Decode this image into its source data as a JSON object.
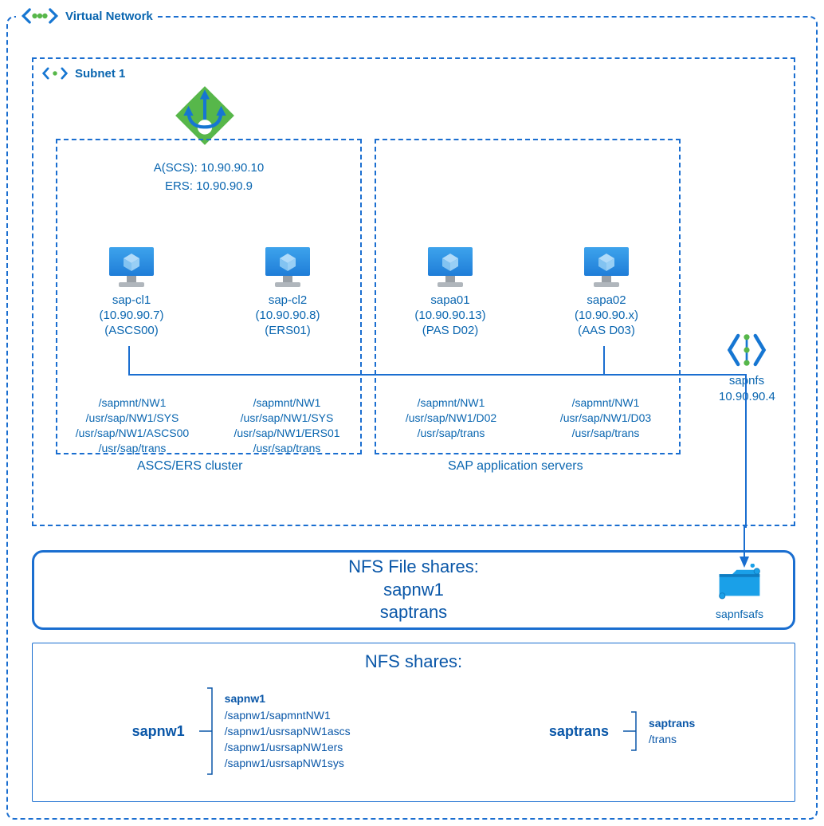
{
  "vnet": {
    "title": "Virtual Network"
  },
  "subnet": {
    "title": "Subnet 1"
  },
  "lb": {
    "ascs_ip": "A(SCS): 10.90.90.10",
    "ers_ip": "ERS: 10.90.90.9"
  },
  "ascs_cluster": {
    "caption": "ASCS/ERS cluster",
    "vm1": {
      "name": "sap-cl1",
      "ip": "(10.90.90.7)",
      "role": "(ASCS00)",
      "paths": [
        "/sapmnt/NW1",
        "/usr/sap/NW1/SYS",
        "/usr/sap/NW1/ASCS00",
        "/usr/sap/trans"
      ]
    },
    "vm2": {
      "name": "sap-cl2",
      "ip": "(10.90.90.8)",
      "role": "(ERS01)",
      "paths": [
        "/sapmnt/NW1",
        "/usr/sap/NW1/SYS",
        "/usr/sap/NW1/ERS01",
        "/usr/sap/trans"
      ]
    }
  },
  "app_cluster": {
    "caption": "SAP application servers",
    "vm1": {
      "name": "sapa01",
      "ip": "(10.90.90.13)",
      "role": "(PAS D02)",
      "paths": [
        "/sapmnt/NW1",
        "/usr/sap/NW1/D02",
        "/usr/sap/trans"
      ]
    },
    "vm2": {
      "name": "sapa02",
      "ip": "(10.90.90.x)",
      "role": "(AAS D03)",
      "paths": [
        "/sapmnt/NW1",
        "/usr/sap/NW1/D03",
        "/usr/sap/trans"
      ]
    }
  },
  "sapnfs": {
    "name": "sapnfs",
    "ip": "10.90.90.4"
  },
  "nfs_fileshares": {
    "title": "NFS File shares:",
    "shares": [
      "sapnw1",
      "saptrans"
    ],
    "storage_label": "sapnfsafs"
  },
  "nfs_shares": {
    "title": "NFS shares:",
    "sapnw1": {
      "name": "sapnw1",
      "header": "sapnw1",
      "paths": [
        "/sapnw1/sapmntNW1",
        "/sapnw1/usrsapNW1ascs",
        "/sapnw1/usrsapNW1ers",
        "/sapnw1/usrsapNW1sys"
      ]
    },
    "saptrans": {
      "name": "saptrans",
      "header": "saptrans",
      "paths": [
        "/trans"
      ]
    }
  }
}
